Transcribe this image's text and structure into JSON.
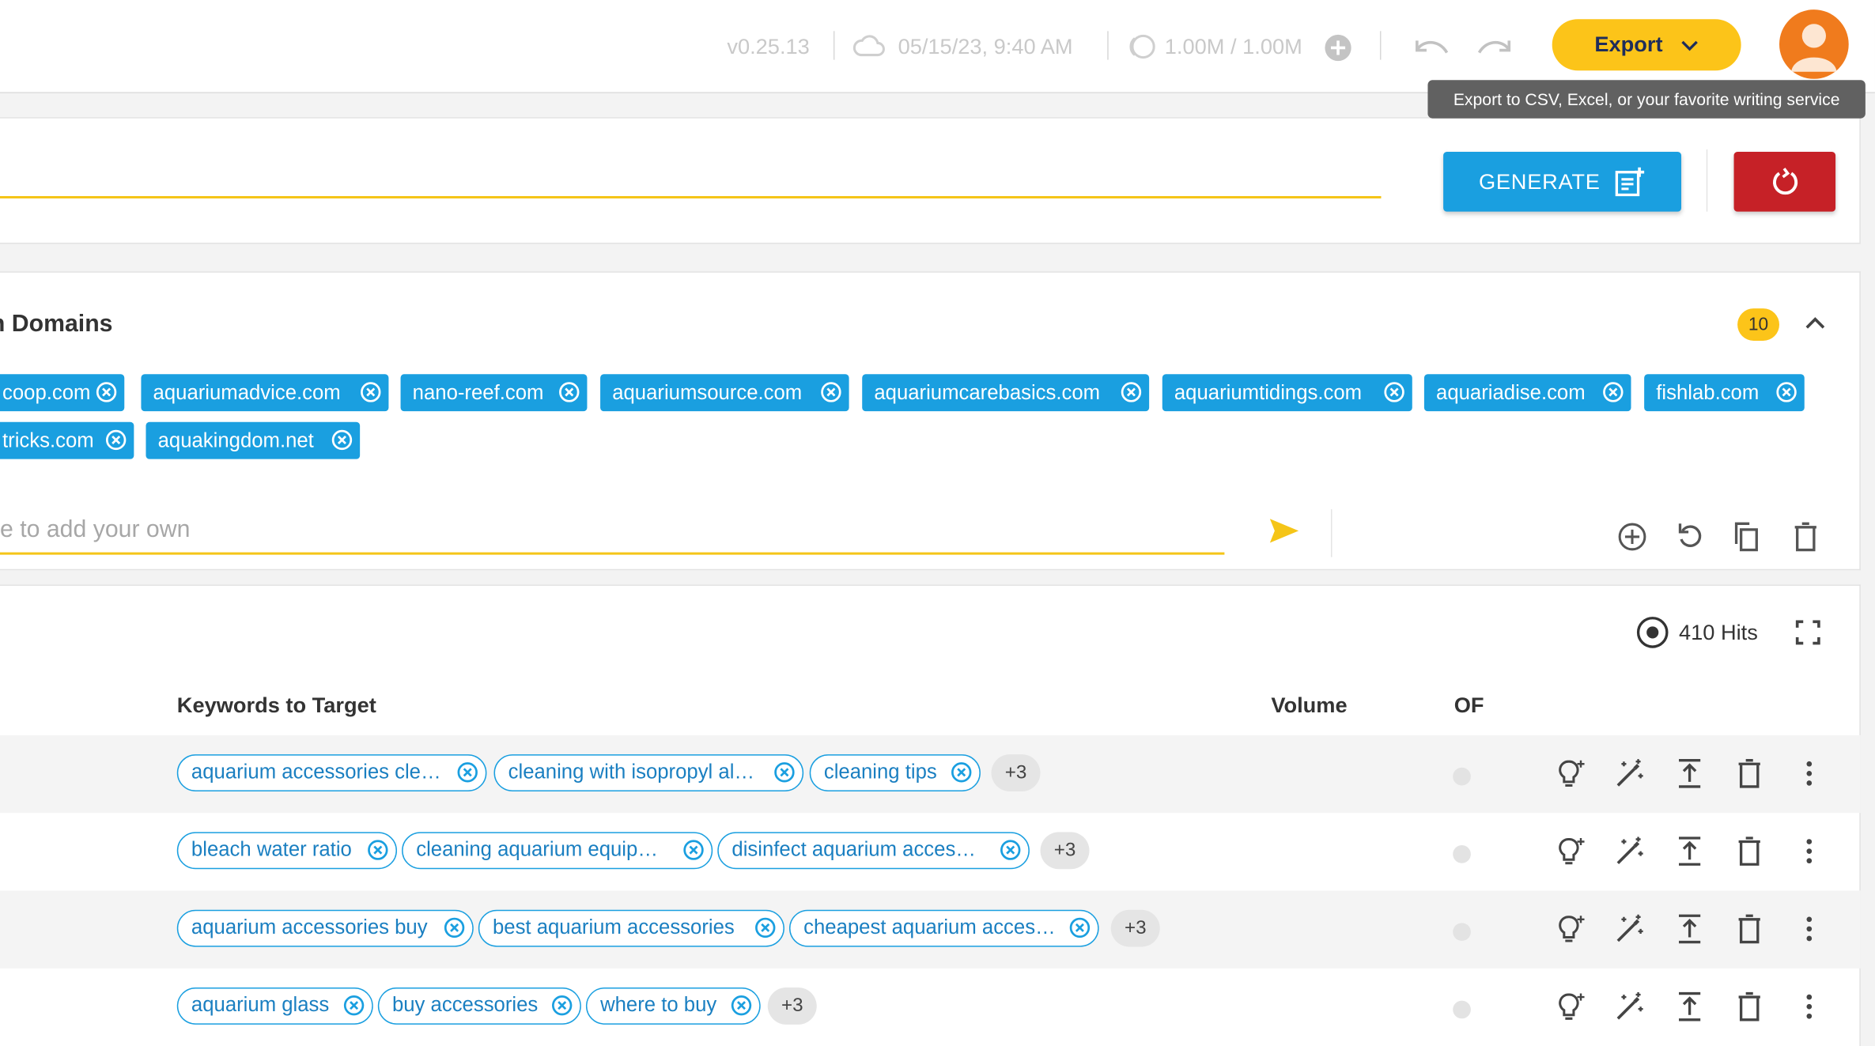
{
  "topbar": {
    "version": "v0.25.13",
    "saved_time": "05/15/23, 9:40 AM",
    "credits": "1.00M / 1.00M",
    "export_label": "Export",
    "export_tooltip": "Export to CSV, Excel, or your favorite writing service"
  },
  "generate": {
    "button_label": "GENERATE"
  },
  "domains": {
    "title": "n Domains",
    "count": "10",
    "row1": [
      "coop.com",
      "aquariumadvice.com",
      "nano-reef.com",
      "aquariumsource.com",
      "aquariumcarebasics.com",
      "aquariumtidings.com",
      "aquariadise.com",
      "fishlab.com"
    ],
    "row2": [
      "tricks.com",
      "aquakingdom.net"
    ],
    "input_placeholder": "e to add your own"
  },
  "keywords": {
    "hits": "410 Hits",
    "col_keywords": "Keywords to Target",
    "col_volume": "Volume",
    "col_of": "OF",
    "rows": [
      {
        "chips": [
          "aquarium accessories cle…",
          "cleaning with isopropyl al…",
          "cleaning tips"
        ],
        "more": "+3"
      },
      {
        "chips": [
          "bleach water ratio",
          "cleaning aquarium equip…",
          "disinfect aquarium acces…"
        ],
        "more": "+3"
      },
      {
        "chips": [
          "aquarium accessories buy",
          "best aquarium accessories",
          "cheapest aquarium acces…"
        ],
        "more": "+3"
      },
      {
        "chips": [
          "aquarium glass",
          "buy accessories",
          "where to buy"
        ],
        "more": "+3"
      }
    ]
  },
  "colors": {
    "accent_yellow": "#fcc419",
    "primary_blue": "#1a9fe0",
    "danger_red": "#c62127"
  }
}
